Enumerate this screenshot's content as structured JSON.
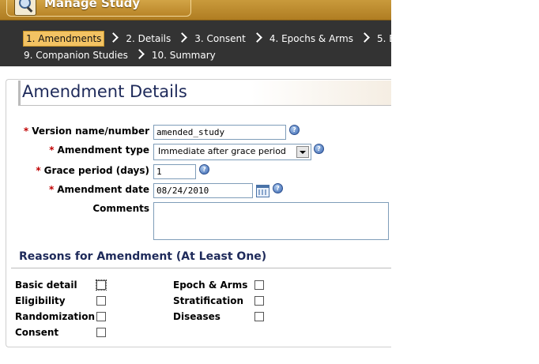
{
  "header": {
    "title": "Manage Study"
  },
  "wizard": {
    "row1": [
      {
        "label": "1. Amendments"
      },
      {
        "label": "2. Details"
      },
      {
        "label": "3. Consent"
      },
      {
        "label": "4. Epochs & Arms"
      },
      {
        "label": "5. El"
      }
    ],
    "row2": [
      {
        "label": "9. Companion Studies"
      },
      {
        "label": "10. Summary"
      }
    ],
    "current_step": "1. Amendments"
  },
  "panel": {
    "title": "Amendment Details"
  },
  "form": {
    "version": {
      "label": "Version name/number",
      "value": "amended_study",
      "required": "*"
    },
    "amendment_type": {
      "label": "Amendment type",
      "value": "Immediate after grace period",
      "required": "*"
    },
    "grace_period": {
      "label": "Grace period (days)",
      "value": "1",
      "required": "*"
    },
    "amendment_date": {
      "label": "Amendment date",
      "value": "08/24/2010",
      "required": "*"
    },
    "comments": {
      "label": "Comments",
      "value": ""
    }
  },
  "reasons": {
    "heading": "Reasons for Amendment (At Least One)",
    "left": [
      {
        "label": "Basic detail",
        "checked": false
      },
      {
        "label": "Eligibility",
        "checked": false
      },
      {
        "label": "Randomization",
        "checked": false
      },
      {
        "label": "Consent",
        "checked": false
      }
    ],
    "right": [
      {
        "label": "Epoch & Arms",
        "checked": false
      },
      {
        "label": "Stratification",
        "checked": false
      },
      {
        "label": "Diseases",
        "checked": false
      }
    ]
  },
  "icons": {
    "help": "help-icon",
    "calendar": "calendar-icon",
    "app": "study-magnifier-icon"
  },
  "colors": {
    "header_bar": "#b98528",
    "nav_background": "#333333",
    "current_step": "#f3c363",
    "required_marker": "#c00000",
    "section_title": "#1e2a5a"
  }
}
